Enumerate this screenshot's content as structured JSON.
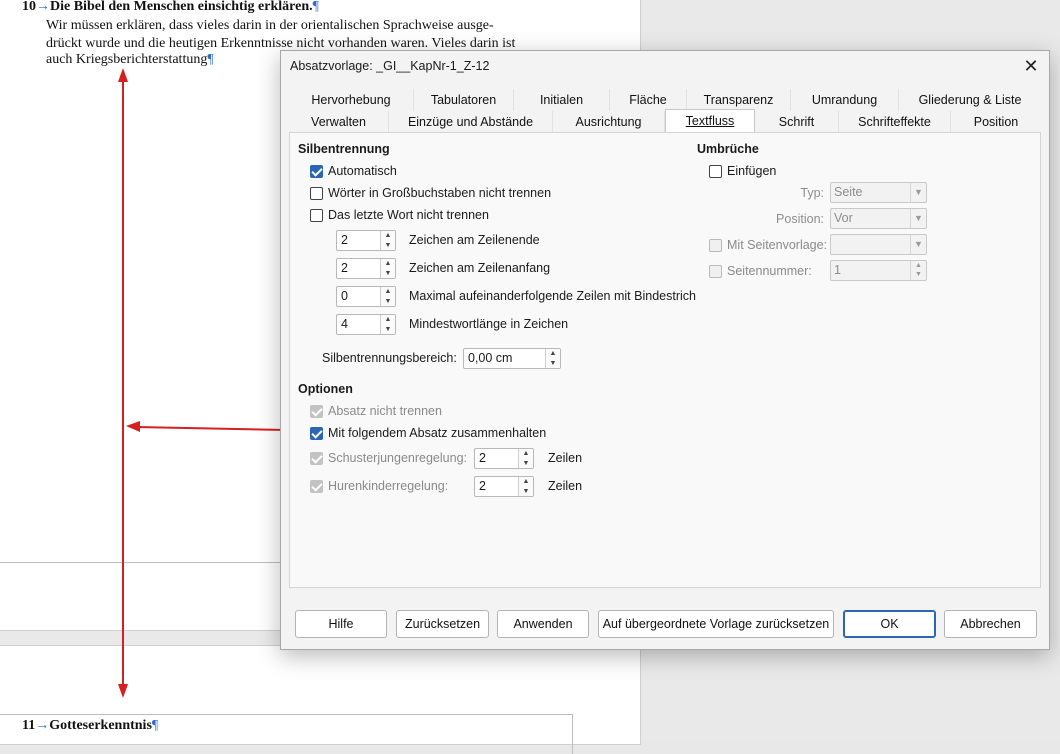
{
  "document": {
    "heading_1_num": "10",
    "heading_1_text": "Die Bibel den Menschen einsichtig erklären.",
    "para_lines": [
      "Wir müssen erklären, dass vieles darin in der orientalischen Sprachweise ausge-",
      "drückt wurde und die heutigen Erkenntnisse nicht vorhanden waren. Vieles darin ist",
      "auch Kriegsberichterstattung"
    ],
    "heading_2_num": "11",
    "heading_2_text": "Gotteserkenntnis",
    "pilcrow": "¶",
    "tab_arrow": "→"
  },
  "dialog": {
    "title": "Absatzvorlage: _GI__KapNr-1_Z-12",
    "close_glyph": "✕",
    "tabs_row1": [
      "Hervorhebung",
      "Tabulatoren",
      "Initialen",
      "Fläche",
      "Transparenz",
      "Umrandung",
      "Gliederung & Liste"
    ],
    "tabs_row2": [
      "Verwalten",
      "Einzüge und Abstände",
      "Ausrichtung",
      "Textfluss",
      "Schrift",
      "Schrifteffekte",
      "Position"
    ],
    "active_tab": "Textfluss",
    "hyphenation": {
      "title": "Silbentrennung",
      "automatic": "Automatisch",
      "no_caps": "Wörter in Großbuchstaben nicht trennen",
      "no_last_word": "Das letzte Wort nicht trennen",
      "chars_end_value": "2",
      "chars_end_label": "Zeichen am Zeilenende",
      "chars_start_value": "2",
      "chars_start_label": "Zeichen am Zeilenanfang",
      "max_lines_value": "0",
      "max_lines_label": "Maximal aufeinanderfolgende Zeilen mit Bindestrich",
      "min_word_value": "4",
      "min_word_label": "Mindestwortlänge in Zeichen",
      "zone_label": "Silbentrennungsbereich:",
      "zone_value": "0,00 cm"
    },
    "breaks": {
      "title": "Umbrüche",
      "insert": "Einfügen",
      "type_label": "Typ:",
      "type_value": "Seite",
      "position_label": "Position:",
      "position_value": "Vor",
      "page_style_label": "Mit Seitenvorlage:",
      "page_style_value": "",
      "page_number_label": "Seitennummer:",
      "page_number_value": "1"
    },
    "options": {
      "title": "Optionen",
      "keep_together": "Absatz nicht trennen",
      "keep_with_next": "Mit folgendem Absatz zusammenhalten",
      "orphan_label": "Schusterjungenregelung:",
      "orphan_value": "2",
      "orphan_unit": "Zeilen",
      "widow_label": "Hurenkinderregelung:",
      "widow_value": "2",
      "widow_unit": "Zeilen"
    },
    "buttons": {
      "help": "Hilfe",
      "reset": "Zurücksetzen",
      "apply": "Anwenden",
      "reset_parent": "Auf übergeordnete Vorlage zurücksetzen",
      "ok": "OK",
      "cancel": "Abbrechen"
    }
  },
  "colors": {
    "annotation_red": "#d61f1f",
    "checkbox_blue": "#2a66b3",
    "pilcrow_blue": "#2f6ad0"
  }
}
